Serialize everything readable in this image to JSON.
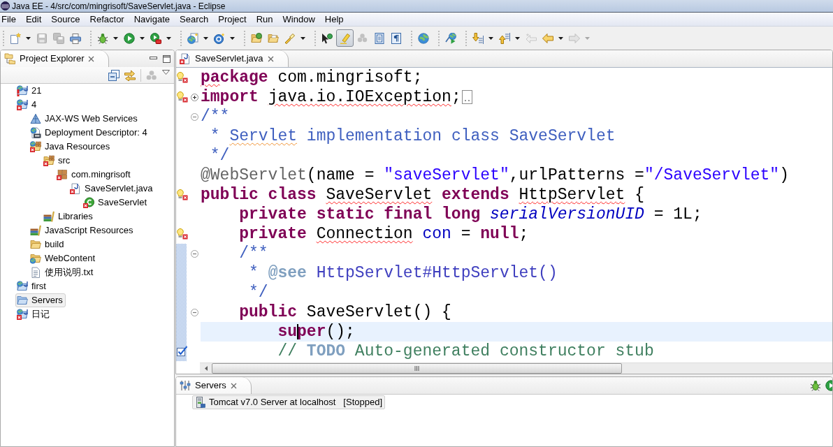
{
  "window": {
    "title": "Java EE - 4/src/com/mingrisoft/SaveServlet.java - Eclipse"
  },
  "menu": [
    "File",
    "Edit",
    "Source",
    "Refactor",
    "Navigate",
    "Search",
    "Project",
    "Run",
    "Window",
    "Help"
  ],
  "toolbar": [
    [
      {
        "kind": "new",
        "dropdown": true,
        "disabled": false
      },
      {
        "kind": "save",
        "disabled": true
      },
      {
        "kind": "save-all",
        "disabled": true
      },
      {
        "kind": "print",
        "disabled": false
      }
    ],
    [
      {
        "kind": "debug",
        "dropdown": true,
        "disabled": false
      },
      {
        "kind": "run",
        "dropdown": true,
        "disabled": false
      },
      {
        "kind": "external-tools",
        "dropdown": true,
        "disabled": false
      }
    ],
    [
      {
        "kind": "new-web",
        "dropdown": true,
        "disabled": false
      },
      {
        "kind": "new-class",
        "dropdown": true,
        "disabled": false
      }
    ],
    [
      {
        "kind": "open-type",
        "disabled": false
      },
      {
        "kind": "open-task",
        "disabled": false
      },
      {
        "kind": "search",
        "dropdown": true,
        "disabled": false
      }
    ],
    [
      {
        "kind": "breadcrumb",
        "disabled": false
      },
      {
        "kind": "mark-occurrences",
        "disabled": false,
        "pressed": true
      },
      {
        "kind": "dots",
        "disabled": true
      },
      {
        "kind": "block-selection",
        "disabled": false,
        "pressed": false
      },
      {
        "kind": "whitespace",
        "disabled": false,
        "pressed": false
      }
    ],
    [
      {
        "kind": "globe",
        "disabled": false
      }
    ],
    [
      {
        "kind": "web-service",
        "disabled": false
      }
    ],
    [
      {
        "kind": "next-annotation",
        "dropdown": true,
        "disabled": false
      },
      {
        "kind": "prev-annotation",
        "dropdown": true,
        "disabled": false
      },
      {
        "kind": "last-edit",
        "disabled": true
      },
      {
        "kind": "back",
        "dropdown": true,
        "disabled": false
      },
      {
        "kind": "forward",
        "dropdown": true,
        "disabled": true
      }
    ]
  ],
  "project_explorer": {
    "tab": {
      "label": "Project Explorer",
      "selected": true
    },
    "tree": [
      {
        "label": "21",
        "kind": "project",
        "alert": true,
        "error": false,
        "selected": false
      },
      {
        "label": "4",
        "kind": "project",
        "error": true,
        "selected": false,
        "children": [
          {
            "label": "JAX-WS Web Services",
            "kind": "web-services",
            "error": false,
            "selected": false
          },
          {
            "label": "Deployment Descriptor: 4",
            "kind": "descriptor",
            "error": false,
            "selected": false
          },
          {
            "label": "Java Resources",
            "kind": "java-resources",
            "error": true,
            "selected": false,
            "children": [
              {
                "label": "src",
                "kind": "source-folder",
                "error": true,
                "selected": false,
                "children": [
                  {
                    "label": "com.mingrisoft",
                    "kind": "package",
                    "error": true,
                    "selected": false,
                    "children": [
                      {
                        "label": "SaveServlet.java",
                        "kind": "java-file",
                        "error": true,
                        "selected": false,
                        "children": [
                          {
                            "label": "SaveServlet",
                            "kind": "class",
                            "error": true,
                            "selected": false
                          }
                        ]
                      }
                    ]
                  }
                ]
              },
              {
                "label": "Libraries",
                "kind": "libraries",
                "error": false,
                "selected": false
              }
            ]
          },
          {
            "label": "JavaScript Resources",
            "kind": "libraries",
            "error": false,
            "selected": false
          },
          {
            "label": "build",
            "kind": "folder",
            "error": false,
            "selected": false
          },
          {
            "label": "WebContent",
            "kind": "web-folder",
            "error": false,
            "selected": false
          },
          {
            "label": "使用说明.txt",
            "kind": "text-file",
            "error": false,
            "selected": false
          }
        ]
      },
      {
        "label": "first",
        "kind": "project",
        "error": false,
        "selected": false
      },
      {
        "label": "Servers",
        "kind": "plain-project",
        "error": false,
        "selected": true
      },
      {
        "label": "日记",
        "kind": "project",
        "error": true,
        "selected": false
      }
    ]
  },
  "editor": {
    "tab": {
      "label": "SaveServlet.java",
      "selected": true,
      "error": true
    },
    "lines": [
      {
        "tokens": [
          {
            "text": "pa",
            "kind": "keyword",
            "error": true
          },
          {
            "text": "ckage",
            "kind": "keyword"
          },
          {
            "text": " com.mingrisoft;",
            "kind": "plain"
          }
        ],
        "quick_fix": true,
        "current": false
      },
      {
        "tokens": [
          {
            "text": "import ",
            "kind": "keyword"
          },
          {
            "text": "java.io.IOException",
            "kind": "plain",
            "error": true
          },
          {
            "text": ";",
            "kind": "plain"
          }
        ],
        "quick_fix": true,
        "folded": true,
        "current": false
      },
      {
        "tokens": [
          {
            "text": "/**",
            "kind": "javadoc"
          }
        ],
        "folded": false,
        "current": false
      },
      {
        "tokens": [
          {
            "text": " * ",
            "kind": "javadoc"
          },
          {
            "text": "Servlet",
            "kind": "javadoc",
            "misspelled": true
          },
          {
            "text": " implementation class SaveServlet",
            "kind": "javadoc"
          }
        ],
        "current": false
      },
      {
        "tokens": [
          {
            "text": " */",
            "kind": "javadoc"
          }
        ],
        "current": false
      },
      {
        "tokens": [
          {
            "text": "@WebServlet",
            "kind": "annotation"
          },
          {
            "text": "(name = ",
            "kind": "plain"
          },
          {
            "text": "\"saveServlet\"",
            "kind": "string"
          },
          {
            "text": ",urlPatterns =",
            "kind": "plain"
          },
          {
            "text": "\"/SaveServlet\"",
            "kind": "string"
          },
          {
            "text": ")",
            "kind": "plain"
          }
        ],
        "current": false
      },
      {
        "tokens": [
          {
            "text": "public class ",
            "kind": "keyword"
          },
          {
            "text": "SaveServlet",
            "kind": "plain",
            "error": true
          },
          {
            "text": " extends ",
            "kind": "keyword"
          },
          {
            "text": "HttpServlet",
            "kind": "plain",
            "error": true
          },
          {
            "text": " {",
            "kind": "plain"
          }
        ],
        "quick_fix": true,
        "current": false
      },
      {
        "tokens": [
          {
            "text": "    private static final long",
            "kind": "keyword"
          },
          {
            "text": " serialVersionUID",
            "kind": "constant"
          },
          {
            "text": " = 1L;",
            "kind": "plain"
          }
        ],
        "current": false
      },
      {
        "tokens": [
          {
            "text": "    private ",
            "kind": "keyword"
          },
          {
            "text": "Connection",
            "kind": "plain",
            "error": true
          },
          {
            "text": " con",
            "kind": "field"
          },
          {
            "text": " = ",
            "kind": "plain"
          },
          {
            "text": "null",
            "kind": "keyword"
          },
          {
            "text": ";",
            "kind": "plain"
          }
        ],
        "quick_fix": true,
        "current": false
      }
    ],
    "member_range": {
      "lines": [
        {
          "tokens": [
            {
              "text": "    /**",
              "kind": "javadoc"
            }
          ],
          "folded": false,
          "current": false
        },
        {
          "tokens": [
            {
              "text": "     * ",
              "kind": "javadoc"
            },
            {
              "text": "@see",
              "kind": "javadoc-tag"
            },
            {
              "text": " HttpServlet#HttpServlet()",
              "kind": "javadoc-link"
            }
          ],
          "current": false
        },
        {
          "tokens": [
            {
              "text": "     */",
              "kind": "javadoc"
            }
          ],
          "current": false
        },
        {
          "tokens": [
            {
              "text": "    public",
              "kind": "keyword"
            },
            {
              "text": " SaveServlet() {",
              "kind": "plain"
            }
          ],
          "folded": false,
          "current": false
        },
        {
          "tokens": [
            {
              "text": "        su",
              "kind": "keyword"
            },
            {
              "text": "per",
              "kind": "keyword",
              "caret": true
            },
            {
              "text": "();",
              "kind": "plain"
            }
          ],
          "current": true
        },
        {
          "tokens": [
            {
              "text": "        // ",
              "kind": "comment"
            },
            {
              "text": "TODO",
              "kind": "task-tag"
            },
            {
              "text": " Auto-generated constructor stub",
              "kind": "comment"
            }
          ],
          "task": true,
          "current": false
        }
      ]
    }
  },
  "servers_view": {
    "tab": {
      "label": "Servers",
      "selected": true
    },
    "servers": [
      {
        "name": "Tomcat v7.0 Server at localhost",
        "state": "[Stopped]",
        "selected": true
      }
    ]
  }
}
